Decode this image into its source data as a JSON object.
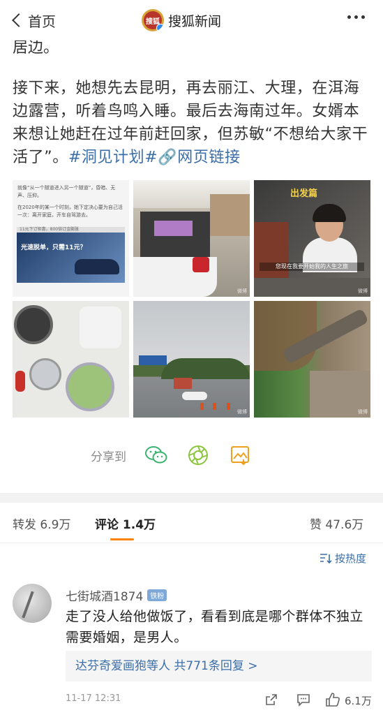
{
  "header": {
    "back_label": "首页",
    "brand_logo_text": "搜狐",
    "brand_name": "搜狐新闻"
  },
  "article": {
    "partial_line": "居边。",
    "paragraph": "接下来，她想先去昆明，再去丽江、大理，在洱海边露营，听着鸟鸣入睡。最后去海南过年。女婿本来想让她赶在过年前赶回家，但苏敏“不想给大家干活了”。",
    "topic_link": "#洞见计划#",
    "web_link": "🔗网页链接"
  },
  "images": {
    "cell1": {
      "line1": "就像“从一个隧道进入另一个隧道”，昏暗、无声、压抑。",
      "line2": "在2020年的某一个时刻，她下定决心要为自己活一次：离开家庭，开车自驾游去。",
      "ad_bar": "11元下订钜惠，800倍订金膨胀",
      "ad_text": "光速脱单，只需11元？"
    },
    "cell3": {
      "title": "出发篇",
      "subtitle": "您现在我要开始我的人生之旅"
    },
    "watermark": "微博"
  },
  "share": {
    "label": "分享到",
    "icons": [
      "wechat-icon",
      "moments-icon",
      "save-image-icon"
    ]
  },
  "tabs": {
    "repost_label": "转发",
    "repost_count": "6.9万",
    "comment_label": "评论",
    "comment_count": "1.4万",
    "like_label": "赞",
    "like_count": "47.6万"
  },
  "sort": {
    "label": "按热度"
  },
  "comment": {
    "username": "七街城酒1874",
    "badge": "铁粉",
    "text": "走了没人给他做饭了，看看到底是哪个群体不独立需要婚姻，是男人。",
    "replies_text": "达芬奇爱画狍等人 共771条回复 >",
    "time": "11-17 12:31",
    "like_count": "6.1万"
  },
  "colors": {
    "link": "#3b6ea8",
    "accent": "#ff8200",
    "wechat_green": "#3cb371",
    "save_orange": "#f0a020"
  }
}
